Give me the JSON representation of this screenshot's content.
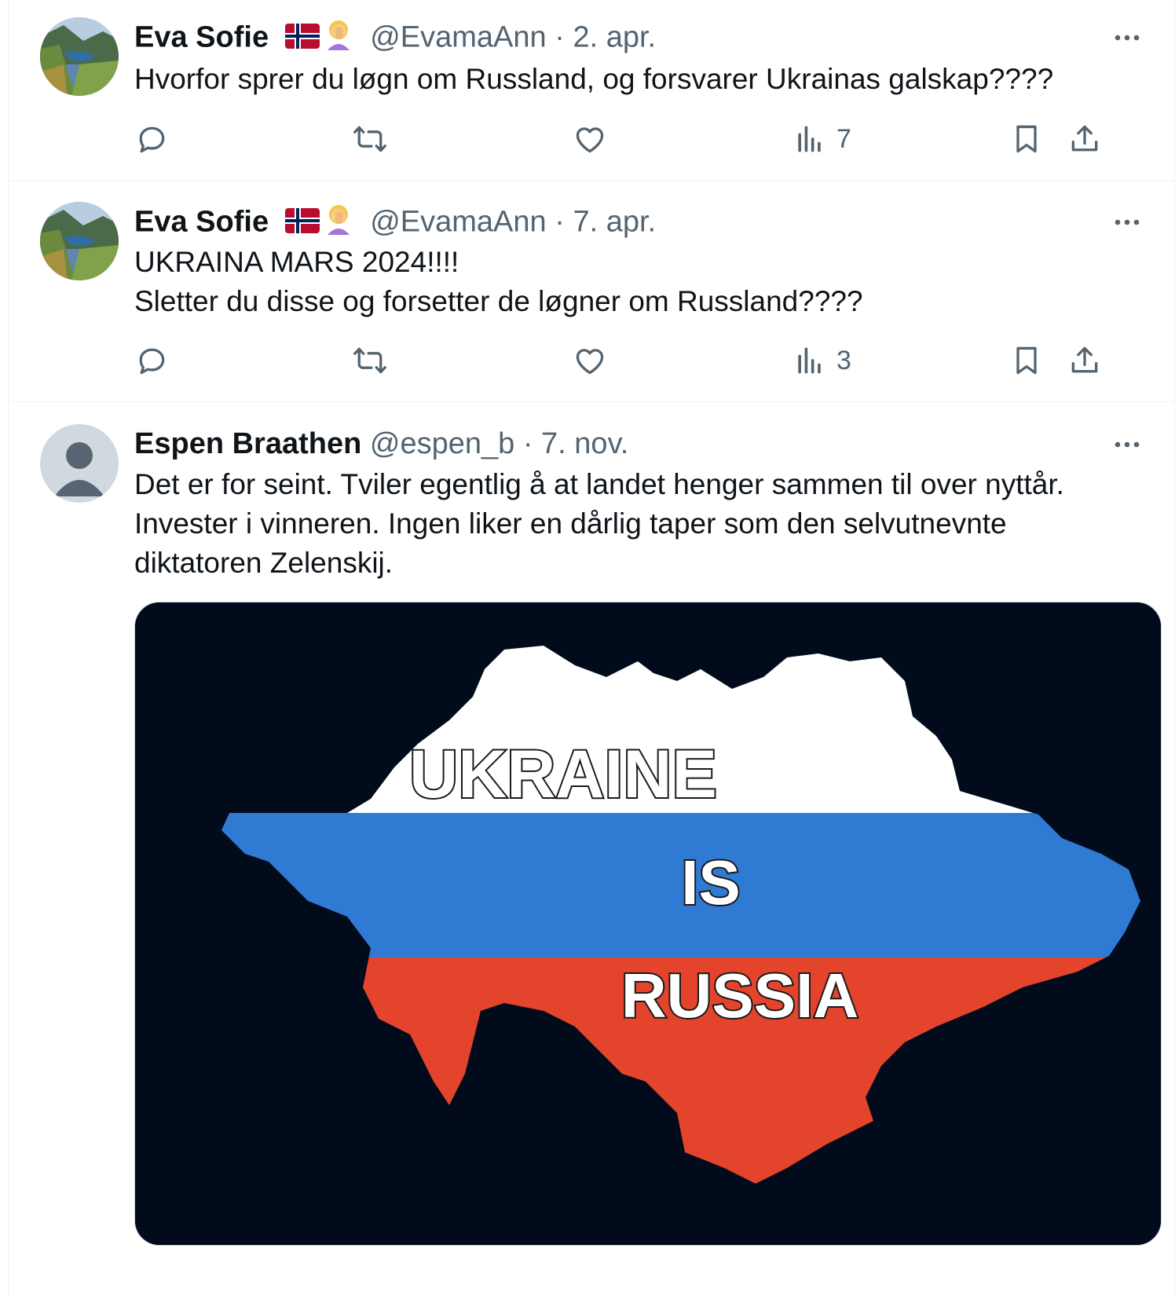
{
  "tweets": [
    {
      "name": "Eva Sofie",
      "handle": "@EvamaAnn",
      "sep": "·",
      "date": "2. apr.",
      "text": "Hvorfor sprer du løgn om Russland, og forsvarer Ukrainas galskap????",
      "views": "7",
      "avatar_icon": "landscape-avatar",
      "emoji_icon": "woman-facepalming-icon"
    },
    {
      "name": "Eva Sofie",
      "handle": "@EvamaAnn",
      "sep": "·",
      "date": "7. apr.",
      "text_line1": "UKRAINA MARS 2024!!!!",
      "text_line2": "Sletter du disse og forsetter de løgner om Russland????",
      "views": "3",
      "avatar_icon": "landscape-avatar",
      "emoji_icon": "woman-facepalming-icon"
    },
    {
      "name": "Espen Braathen",
      "handle": "@espen_b",
      "sep": "·",
      "date": "7. nov.",
      "text": "Det er for seint. Tviler egentlig å at landet henger sammen til over nyttår. Invester i vinneren. Ingen liker en dårlig taper som den selvutnevnte diktatoren Zelenskij.",
      "avatar_icon": "default-profile-avatar",
      "media": {
        "word1": "UKRAINE",
        "word2": "IS",
        "word3": "RUSSIA",
        "colors": {
          "white": "#ffffff",
          "blue": "#2f7ad3",
          "red": "#e4432c",
          "background": "#020b1b"
        }
      }
    }
  ],
  "icons": {
    "reply": "reply-icon",
    "retweet": "retweet-icon",
    "like": "heart-icon",
    "views": "views-icon",
    "bookmark": "bookmark-icon",
    "share": "share-icon",
    "more": "more-dots-icon"
  }
}
